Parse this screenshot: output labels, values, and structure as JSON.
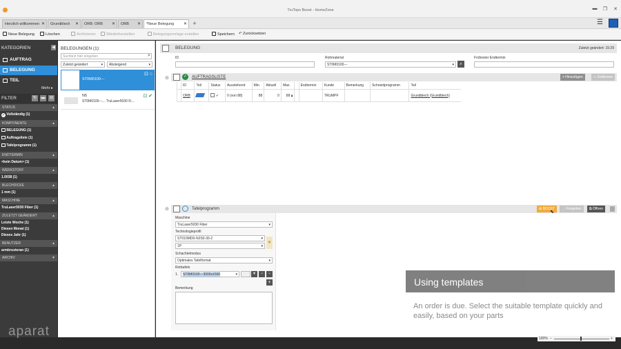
{
  "window": {
    "title": "TruTops Boost - HomeZone",
    "min": "▬",
    "restore": "❐",
    "close": "✕"
  },
  "tabs": [
    {
      "label": "Herzlich willkommen"
    },
    {
      "label": "Grundblech"
    },
    {
      "label": "ORB: ORB"
    },
    {
      "label": "ORB"
    },
    {
      "label": "*Neue Belegung"
    }
  ],
  "tab_add": "+",
  "menu_icon": "☰",
  "toolbar": {
    "new": "Neue Belegung",
    "delete": "Löschen",
    "archive": "Archivieren",
    "restore": "Wiederherstellen",
    "template": "Belegungsvorlage erstellen",
    "save": "Speichern",
    "undo": "Zurücksetzen"
  },
  "sidebar": {
    "categories_title": "KATEGORIEN",
    "categories": [
      "AUFTRAG",
      "BELEGUNG",
      "TEIL"
    ],
    "more": "Mehr",
    "filter_title": "FILTER",
    "sections": [
      {
        "label": "STATUS",
        "items": [
          "Vollständig (1)"
        ]
      },
      {
        "label": "KOMPONENTE",
        "items": [
          "BELEGUNG (1)",
          "Auftragsliste (1)",
          "Tafelprogramm (1)"
        ]
      },
      {
        "label": "ENDTERMIN",
        "items": [
          "<kein Datum> (1)"
        ]
      },
      {
        "label": "WERKSTOFF",
        "items": [
          "1.0038 (1)"
        ]
      },
      {
        "label": "BLECHDICKE",
        "items": [
          "1 mm (1)"
        ]
      },
      {
        "label": "MASCHINE",
        "items": [
          "TruLaser5030 Fiber (1)"
        ]
      },
      {
        "label": "ZULETZT GEÄNDERT",
        "items": [
          "Letzte Woche (1)",
          "Diesen Monat (1)",
          "Dieses Jahr (1)"
        ]
      },
      {
        "label": "BENUTZER",
        "items": [
          "armbrusteran (1)"
        ]
      },
      {
        "label": "ARCHIV",
        "items": []
      }
    ]
  },
  "list": {
    "title": "BELEGUNGEN (1):",
    "search_placeholder": "Suchtext hier eingeben",
    "sort_field": "Zuletzt geändert",
    "sort_order": "Absteigend",
    "rows": [
      {
        "title": "ST0M0100---"
      },
      {
        "line1": "N5",
        "line2": "ST0M0100---... TruLaser5030 Fi..."
      }
    ]
  },
  "main": {
    "title": "BELEGUNG",
    "last_changed": "Zuletzt geändert: 15:29",
    "fields": {
      "id_label": "ID",
      "material_label": "Rohmaterial",
      "material_value": "ST0M0100---",
      "earliest_label": "Frühester Endtermin"
    },
    "orders": {
      "title": "AUFTRAGSLISTE",
      "add": "+ Hinzufügen",
      "remove": "— Entfernen",
      "headers": [
        "ID",
        "Teil",
        "Status",
        "Ausstehend",
        "Min.",
        "Aktuell",
        "Max.",
        "",
        "Endtermin",
        "Kunde",
        "Bemerkung",
        "Schneidprogramm",
        "Teil"
      ],
      "row": {
        "id": "ORB",
        "pending": "0 (von 88)",
        "min": "88",
        "current": "0",
        "max": "88",
        "customer": "TRUMPF",
        "part": "Grundblech (Grundblech)"
      }
    },
    "sheet": {
      "title": "Tafelprogramm",
      "boost": "BOOST",
      "release": "Freigeben",
      "open": "Öffnen",
      "machine_label": "Maschine",
      "machine_value": "TruLaser5030 Fiber",
      "tech_label": "Technologieprofil",
      "tech_value": "ST010MD0-N2S0-30-2",
      "tech_sub": "1P",
      "nesting_label": "Schachtelmodus",
      "nesting_value": "Optimales Tafelformat",
      "sheets_label": "Rohtafeln",
      "sheet_index": "1.",
      "sheet_value": "ST0M0100---3000x1500",
      "remark_label": "Bemerkung"
    }
  },
  "overlay": {
    "title": "Using templates",
    "desc": "An order is due. Select the suitable template quickly and easily, based on your parts"
  },
  "status": {
    "zoom": "100%"
  },
  "watermark": "aparat",
  "colors": {
    "accent": "#2f8fd8",
    "boost": "#f2a93b",
    "sidebar": "#3b3b3b"
  }
}
